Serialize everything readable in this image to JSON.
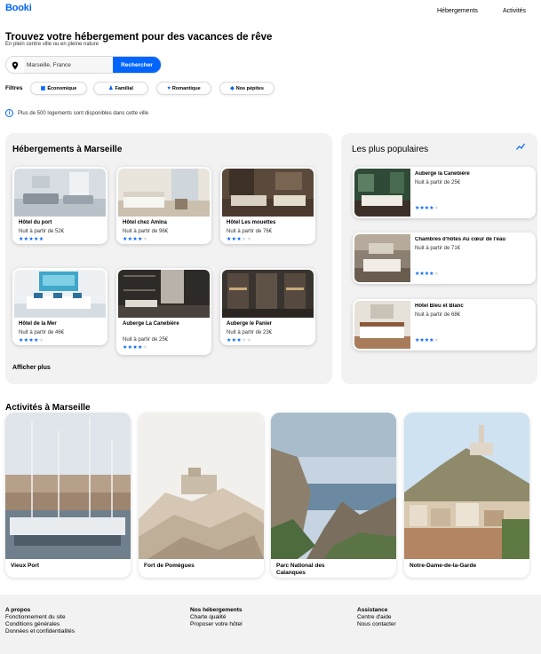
{
  "header": {
    "logo": "Booki",
    "nav": [
      "Hébergements",
      "Activités"
    ]
  },
  "hero": {
    "title": "Trouvez votre hébergement pour des vacances de rêve",
    "subtitle": "En plein centre ville ou en pleine nature",
    "search": {
      "value": "Marseille, France",
      "button": "Rechercher"
    }
  },
  "filters": {
    "label": "Filtres",
    "chips": [
      {
        "label": "Économique",
        "icon": "money-icon"
      },
      {
        "label": "Familial",
        "icon": "child-icon"
      },
      {
        "label": "Romantique",
        "icon": "heart-icon"
      },
      {
        "label": "Nos pépites",
        "icon": "gem-icon"
      }
    ]
  },
  "info": {
    "text": "Plus de 500 logements sont disponibles dans cette ville"
  },
  "lodgings": {
    "title": "Hébergements à Marseille",
    "show_more": "Afficher plus",
    "items": [
      {
        "name": "Hôtel du port",
        "price": "Nuit à partir de 52€",
        "rating": 5
      },
      {
        "name": "Hôtel chez Amina",
        "price": "Nuit à partir de 96€",
        "rating": 4
      },
      {
        "name": "Hôtel Les mouettes",
        "price": "Nuit à partir de 76€",
        "rating": 3
      },
      {
        "name": "Hôtel de la Mer",
        "price": "Nuit à partir de 46€",
        "rating": 4
      },
      {
        "name": "Auberge La Canebière",
        "price": "Nuit à partir de 25€",
        "rating": 4
      },
      {
        "name": "Auberge le Panier",
        "price": "Nuit à partir de 23€",
        "rating": 3
      }
    ]
  },
  "popular": {
    "title": "Les plus populaires",
    "items": [
      {
        "name": "Auberge la Canebière",
        "price": "Nuit à partir de 25€",
        "rating": 4
      },
      {
        "name": "Chambres d'hôtes Au cœur de l'eau",
        "price": "Nuit à partir de 71€",
        "rating": 4
      },
      {
        "name": "Hôtel Bleu et Blanc",
        "price": "Nuit à partir de 68€",
        "rating": 4
      }
    ]
  },
  "activities": {
    "title": "Activités à Marseille",
    "items": [
      {
        "name": "Vieux Port"
      },
      {
        "name": "Fort de Pomègues"
      },
      {
        "name": "Parc National des Calanques"
      },
      {
        "name": "Notre-Dame-de-la-Garde"
      }
    ]
  },
  "footer": {
    "columns": [
      {
        "title": "A propos",
        "links": [
          "Fonctionnement du site",
          "Conditions générales",
          "Données et confidentialités"
        ]
      },
      {
        "title": "Nos hébergements",
        "links": [
          "Charte qualité",
          "Proposer votre hôtel"
        ]
      },
      {
        "title": "Assistance",
        "links": [
          "Centre d'aide",
          "Nous contacter"
        ]
      }
    ]
  },
  "colors": {
    "accent": "#0065FC",
    "panel": "#F2F2F2"
  }
}
